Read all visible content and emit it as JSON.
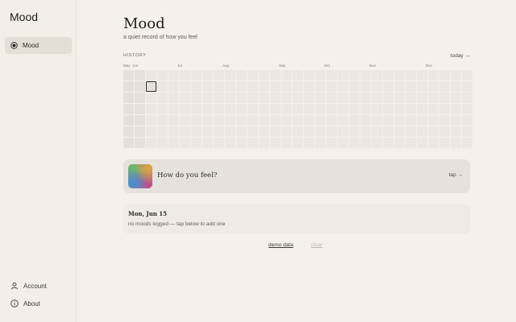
{
  "sidebar": {
    "app_title": "Mood",
    "nav": [
      {
        "label": "Mood",
        "icon": "ring-icon",
        "active": true
      }
    ],
    "bottom": [
      {
        "label": "Account",
        "icon": "person-icon"
      },
      {
        "label": "About",
        "icon": "info-icon"
      }
    ]
  },
  "header": {
    "title": "Mood",
    "subtitle": "a quiet record of how you feel"
  },
  "history": {
    "label": "HISTORY",
    "today_link": "today →",
    "months": [
      "May",
      "Jun",
      "Jul",
      "Aug",
      "Sep",
      "Oct",
      "Nov",
      "Dec"
    ],
    "weeks": 31,
    "days_per_week": 7,
    "today_marker": {
      "week": 2,
      "day": 1
    }
  },
  "feel_card": {
    "question": "How do you feel?",
    "tap_label": "tap →"
  },
  "day_card": {
    "date": "Mon, Jun 15",
    "empty_text": "no moods logged — tap below to add one"
  },
  "footer": {
    "demo_label": "demo data",
    "clear_label": "clear"
  },
  "colors": {
    "background": "#f4f1ea",
    "cell_empty": "#ebe8e1",
    "accent": "#2b2a27"
  }
}
